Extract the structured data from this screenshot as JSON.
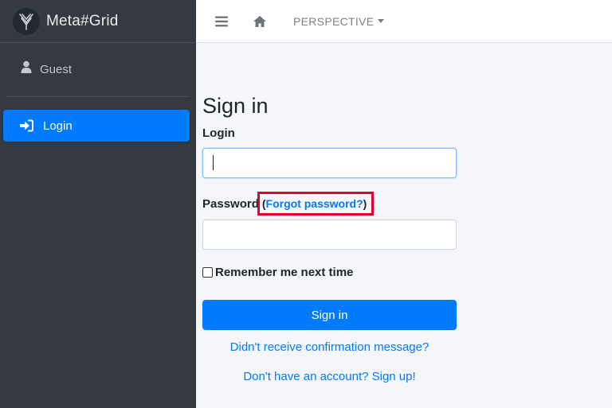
{
  "brand": {
    "name": "Meta#Grid"
  },
  "user": {
    "name": "Guest"
  },
  "sidebar": {
    "items": [
      {
        "label": "Login",
        "icon": "sign-in-icon"
      }
    ]
  },
  "topbar": {
    "perspective_label": "PERSPECTIVE"
  },
  "form": {
    "title": "Sign in",
    "login_label": "Login",
    "login_value": "",
    "password_label": "Password",
    "forgot_open": "(",
    "forgot_label": "Forgot password?",
    "forgot_close": ")",
    "password_value": "",
    "remember_label": "Remember me next time",
    "remember_checked": false,
    "submit_label": "Sign in",
    "confirmation_link": "Didn't receive confirmation message?",
    "signup_link": "Don't have an account? Sign up!"
  },
  "colors": {
    "sidebar_bg": "#343a40",
    "accent": "#007bff",
    "highlight_box": "#e4002b",
    "content_bg": "#f4f6f9"
  }
}
